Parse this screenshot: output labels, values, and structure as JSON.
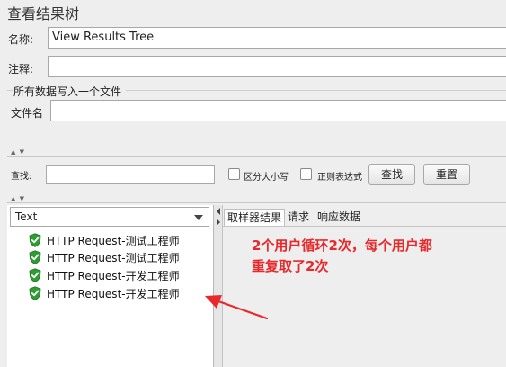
{
  "window": {
    "title": "查看结果树"
  },
  "form": {
    "name_label": "名称:",
    "name_value": "View Results Tree",
    "comment_label": "注释:",
    "comment_value": "",
    "write_all_label": "所有数据写入一个文件",
    "filename_label": "文件名",
    "filename_value": ""
  },
  "search": {
    "label": "查找:",
    "value": "",
    "case_sensitive_label": "区分大小写",
    "case_sensitive_checked": false,
    "regex_label": "正则表达式",
    "regex_checked": false,
    "find_button": "查找",
    "reset_button": "重置"
  },
  "renderer": {
    "selected": "Text"
  },
  "tree": {
    "items": [
      {
        "label": "HTTP Request-测试工程师",
        "status": "success"
      },
      {
        "label": "HTTP Request-测试工程师",
        "status": "success"
      },
      {
        "label": "HTTP Request-开发工程师",
        "status": "success"
      },
      {
        "label": "HTTP Request-开发工程师",
        "status": "success"
      }
    ]
  },
  "tabs": [
    {
      "label": "取样器结果",
      "active": true
    },
    {
      "label": "请求",
      "active": false
    },
    {
      "label": "响应数据",
      "active": false
    }
  ],
  "annotation": {
    "line1": "2个用户循环2次，每个用户都",
    "line2": "重复取了2次",
    "color": "#e8282a"
  },
  "icons": {
    "success": "green-shield-check-icon",
    "collapse": "collapse-arrows-icon"
  }
}
